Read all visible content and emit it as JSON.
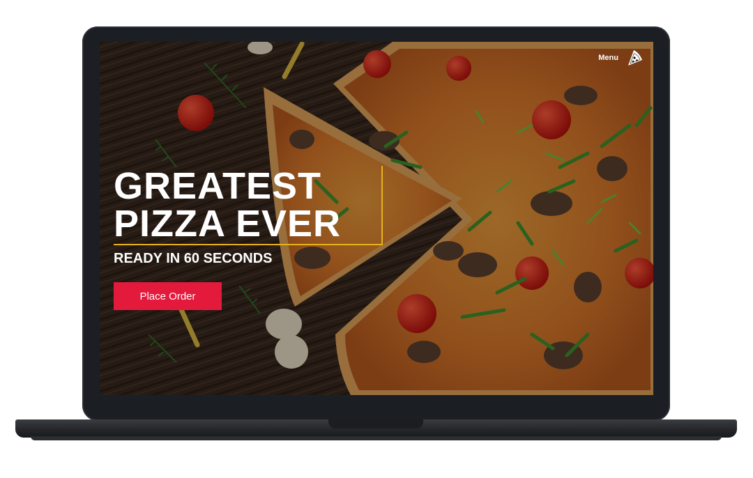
{
  "nav": {
    "menu_label": "Menu",
    "menu_icon": "pizza-slice-icon"
  },
  "hero": {
    "headline_line1": "GREATEST",
    "headline_line2": "PIZZA EVER",
    "subhead": "READY IN 60 SECONDS",
    "cta_label": "Place Order"
  },
  "colors": {
    "accent_red": "#e31a3b",
    "accent_gold": "#e8b21a",
    "laptop_bezel": "#1b1f24"
  }
}
